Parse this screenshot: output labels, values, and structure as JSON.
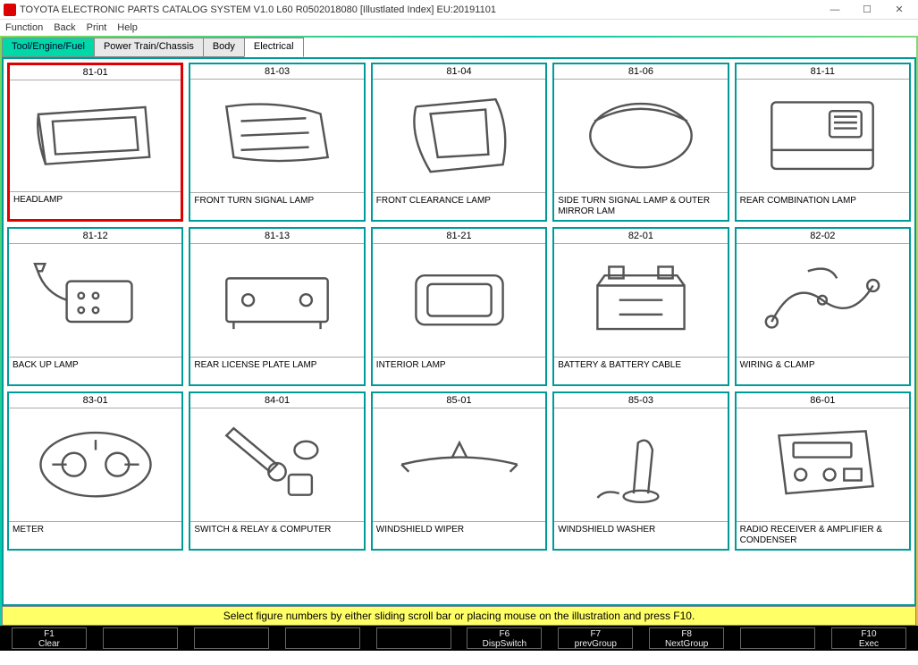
{
  "window": {
    "title": "TOYOTA ELECTRONIC PARTS CATALOG SYSTEM V1.0 L60 R0502018080 [Illustlated Index] EU:20191101"
  },
  "menu": [
    "Function",
    "Back",
    "Print",
    "Help"
  ],
  "tabs": [
    {
      "label": "Tool/Engine/Fuel",
      "active": true
    },
    {
      "label": "Power Train/Chassis",
      "active": false
    },
    {
      "label": "Body",
      "active": false
    },
    {
      "label": "Electrical",
      "active": false,
      "selected": true
    }
  ],
  "cards": [
    {
      "code": "81-01",
      "label": "HEADLAMP",
      "selected": true
    },
    {
      "code": "81-03",
      "label": "FRONT TURN SIGNAL LAMP"
    },
    {
      "code": "81-04",
      "label": "FRONT CLEARANCE LAMP"
    },
    {
      "code": "81-06",
      "label": "SIDE TURN SIGNAL LAMP & OUTER MIRROR LAM"
    },
    {
      "code": "81-11",
      "label": "REAR COMBINATION LAMP"
    },
    {
      "code": "81-12",
      "label": "BACK UP LAMP"
    },
    {
      "code": "81-13",
      "label": "REAR LICENSE PLATE LAMP"
    },
    {
      "code": "81-21",
      "label": "INTERIOR LAMP"
    },
    {
      "code": "82-01",
      "label": "BATTERY & BATTERY CABLE"
    },
    {
      "code": "82-02",
      "label": "WIRING & CLAMP"
    },
    {
      "code": "83-01",
      "label": "METER"
    },
    {
      "code": "84-01",
      "label": "SWITCH & RELAY & COMPUTER"
    },
    {
      "code": "85-01",
      "label": "WINDSHIELD WIPER"
    },
    {
      "code": "85-03",
      "label": "WINDSHIELD WASHER"
    },
    {
      "code": "86-01",
      "label": "RADIO RECEIVER & AMPLIFIER & CONDENSER"
    }
  ],
  "hint": "Select figure numbers by either sliding scroll bar or placing mouse on the illustration and press F10.",
  "fkeys": [
    {
      "key": "F1",
      "label": "Clear"
    },
    {
      "key": "",
      "label": ""
    },
    {
      "key": "",
      "label": ""
    },
    {
      "key": "",
      "label": ""
    },
    {
      "key": "",
      "label": ""
    },
    {
      "key": "F6",
      "label": "DispSwitch"
    },
    {
      "key": "F7",
      "label": "prevGroup"
    },
    {
      "key": "F8",
      "label": "NextGroup"
    },
    {
      "key": "",
      "label": ""
    },
    {
      "key": "F10",
      "label": "Exec"
    }
  ],
  "icons": {
    "min": "—",
    "max": "☐",
    "close": "✕"
  }
}
